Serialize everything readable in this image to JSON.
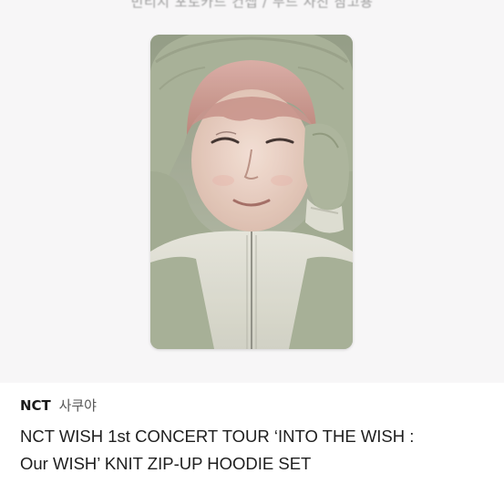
{
  "top_caption": "빈티지 포토카드 컨셉 / 무드 사진 참고용",
  "product": {
    "brand": "NCT",
    "brand_sub": "사쿠야",
    "title_line1": "NCT WISH 1st CONCERT TOUR ‘INTO THE WISH :",
    "title_line2": "Our WISH’ KNIT ZIP-UP HOODIE SET"
  },
  "photocard": {
    "alt": "photocard of person in green knit hoodie"
  },
  "colors": {
    "background": "#f7f6f7",
    "hoodie_green": "#9fa88f",
    "hoodie_cream": "#dcdccf",
    "hair_pink": "#cf9d95"
  }
}
